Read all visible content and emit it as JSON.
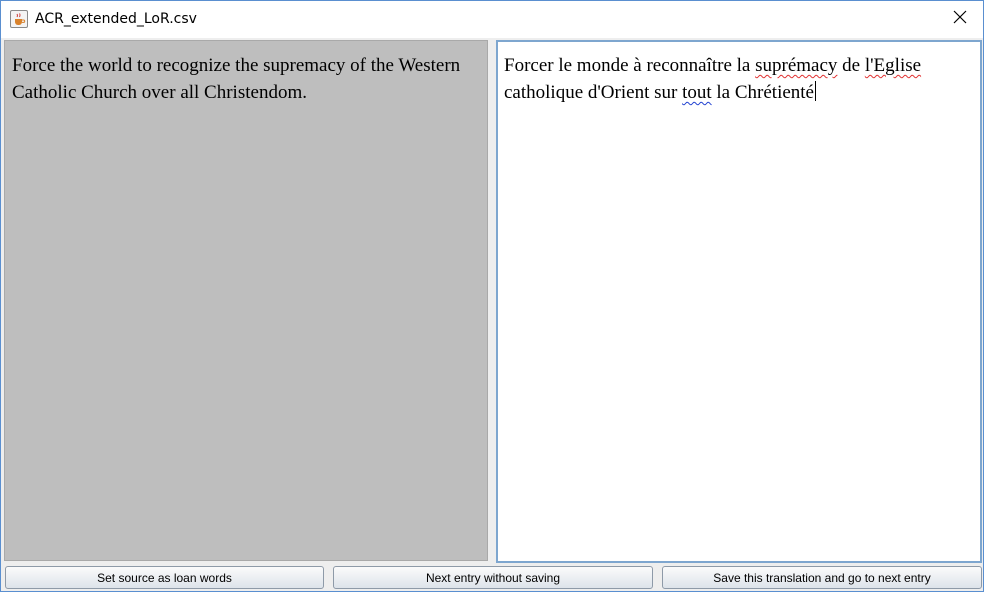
{
  "window": {
    "title": "ACR_extended_LoR.csv",
    "icons": {
      "app": "java-cup-icon",
      "close": "close-icon"
    }
  },
  "source": {
    "text": "Force the world to recognize the supremacy of the Western Catholic Church over all Christendom."
  },
  "target": {
    "parts": [
      "Forcer le monde à reconnaître la ",
      "suprémacy",
      " de ",
      "l'Eglise",
      " catholique d'Orient sur ",
      "tout",
      " la Chrétienté"
    ],
    "spellcheck_colors": {
      "misspelled": "#e03030",
      "grammar": "#2040d0"
    }
  },
  "buttons": {
    "loan_words": "Set source as loan words",
    "next_no_save": "Next entry without saving",
    "save_next": "Save this translation and go to next entry"
  }
}
